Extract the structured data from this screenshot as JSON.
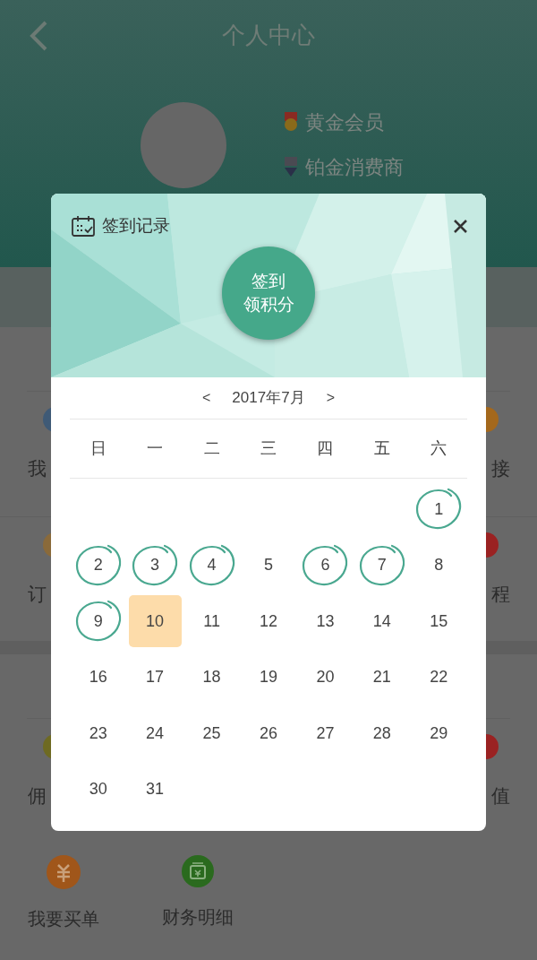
{
  "header": {
    "title": "个人中心"
  },
  "profile": {
    "badges": [
      {
        "kind": "medal",
        "label": "黄金会员"
      },
      {
        "kind": "diamond",
        "label": "铂金消费商"
      }
    ]
  },
  "menu": {
    "sections": [
      {
        "rows": [
          {
            "left": {
              "label": "我",
              "color": "#3f5a76"
            },
            "right": {
              "label": "接",
              "color": "#a4681c"
            }
          },
          {
            "left": {
              "label": "订",
              "color": "#8a6a3a"
            },
            "right": {
              "label": "程",
              "color": "#9a2222"
            }
          }
        ]
      },
      {
        "rows": [
          {
            "left": {
              "label": "佣",
              "color": "#6e6a22"
            },
            "right": {
              "label": "值",
              "color": "#9a2222"
            }
          }
        ]
      }
    ],
    "bottom_items": [
      {
        "kind": "yen",
        "label": "我要买单"
      },
      {
        "kind": "wallet",
        "label": "财务明细"
      }
    ]
  },
  "modal": {
    "title": "签到记录",
    "sign_button": {
      "lines": [
        "签到",
        "领积分"
      ]
    },
    "calendar": {
      "prev": "<",
      "month": "2017年7月",
      "next": ">",
      "weekdays": [
        "日",
        "一",
        "二",
        "三",
        "四",
        "五",
        "六"
      ],
      "weeks": [
        [
          {
            "day": "1",
            "signed": true,
            "selected": false
          }
        ],
        [
          {
            "day": "2",
            "signed": true,
            "selected": false
          },
          {
            "day": "3",
            "signed": true,
            "selected": false
          },
          {
            "day": "4",
            "signed": true,
            "selected": false
          },
          {
            "day": "5",
            "signed": false,
            "selected": false
          },
          {
            "day": "6",
            "signed": true,
            "selected": false
          },
          {
            "day": "7",
            "signed": true,
            "selected": false
          },
          {
            "day": "8",
            "signed": false,
            "selected": false
          }
        ],
        [
          {
            "day": "9",
            "signed": true,
            "selected": false
          },
          {
            "day": "10",
            "signed": false,
            "selected": true
          },
          {
            "day": "11",
            "signed": false,
            "selected": false
          },
          {
            "day": "12",
            "signed": false,
            "selected": false
          },
          {
            "day": "13",
            "signed": false,
            "selected": false
          },
          {
            "day": "14",
            "signed": false,
            "selected": false
          },
          {
            "day": "15",
            "signed": false,
            "selected": false
          }
        ],
        [
          {
            "day": "16",
            "signed": false,
            "selected": false
          },
          {
            "day": "17",
            "signed": false,
            "selected": false
          },
          {
            "day": "18",
            "signed": false,
            "selected": false
          },
          {
            "day": "19",
            "signed": false,
            "selected": false
          },
          {
            "day": "20",
            "signed": false,
            "selected": false
          },
          {
            "day": "21",
            "signed": false,
            "selected": false
          },
          {
            "day": "22",
            "signed": false,
            "selected": false
          }
        ],
        [
          {
            "day": "23",
            "signed": false,
            "selected": false
          },
          {
            "day": "24",
            "signed": false,
            "selected": false
          },
          {
            "day": "25",
            "signed": false,
            "selected": false
          },
          {
            "day": "26",
            "signed": false,
            "selected": false
          },
          {
            "day": "27",
            "signed": false,
            "selected": false
          },
          {
            "day": "28",
            "signed": false,
            "selected": false
          },
          {
            "day": "29",
            "signed": false,
            "selected": false
          }
        ],
        [
          {
            "day": "30",
            "signed": false,
            "selected": false
          },
          {
            "day": "31",
            "signed": false,
            "selected": false
          }
        ]
      ]
    }
  }
}
